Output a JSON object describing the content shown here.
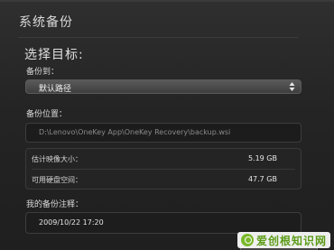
{
  "window": {
    "title": "系统备份"
  },
  "main": {
    "heading": "选择目标:",
    "backup_to": {
      "label": "备份到：",
      "selected": "默认路径"
    },
    "backup_location": {
      "label": "备份位置：",
      "path": "D:\\Lenovo\\OneKey App\\OneKey Recovery\\backup.wsi"
    },
    "stats": [
      {
        "label": "估计映像大小：",
        "value": "5.19 GB"
      },
      {
        "label": "可用硬盘空间：",
        "value": "47.7 GB"
      }
    ],
    "note": {
      "label": "我的备份注释：",
      "value": "2009/10/22 17:20"
    }
  },
  "watermark": {
    "text": "爱创根知识网"
  },
  "colors": {
    "background": "#262626",
    "text": "#e6e6e6",
    "watermark_green": "#7ab92a"
  }
}
